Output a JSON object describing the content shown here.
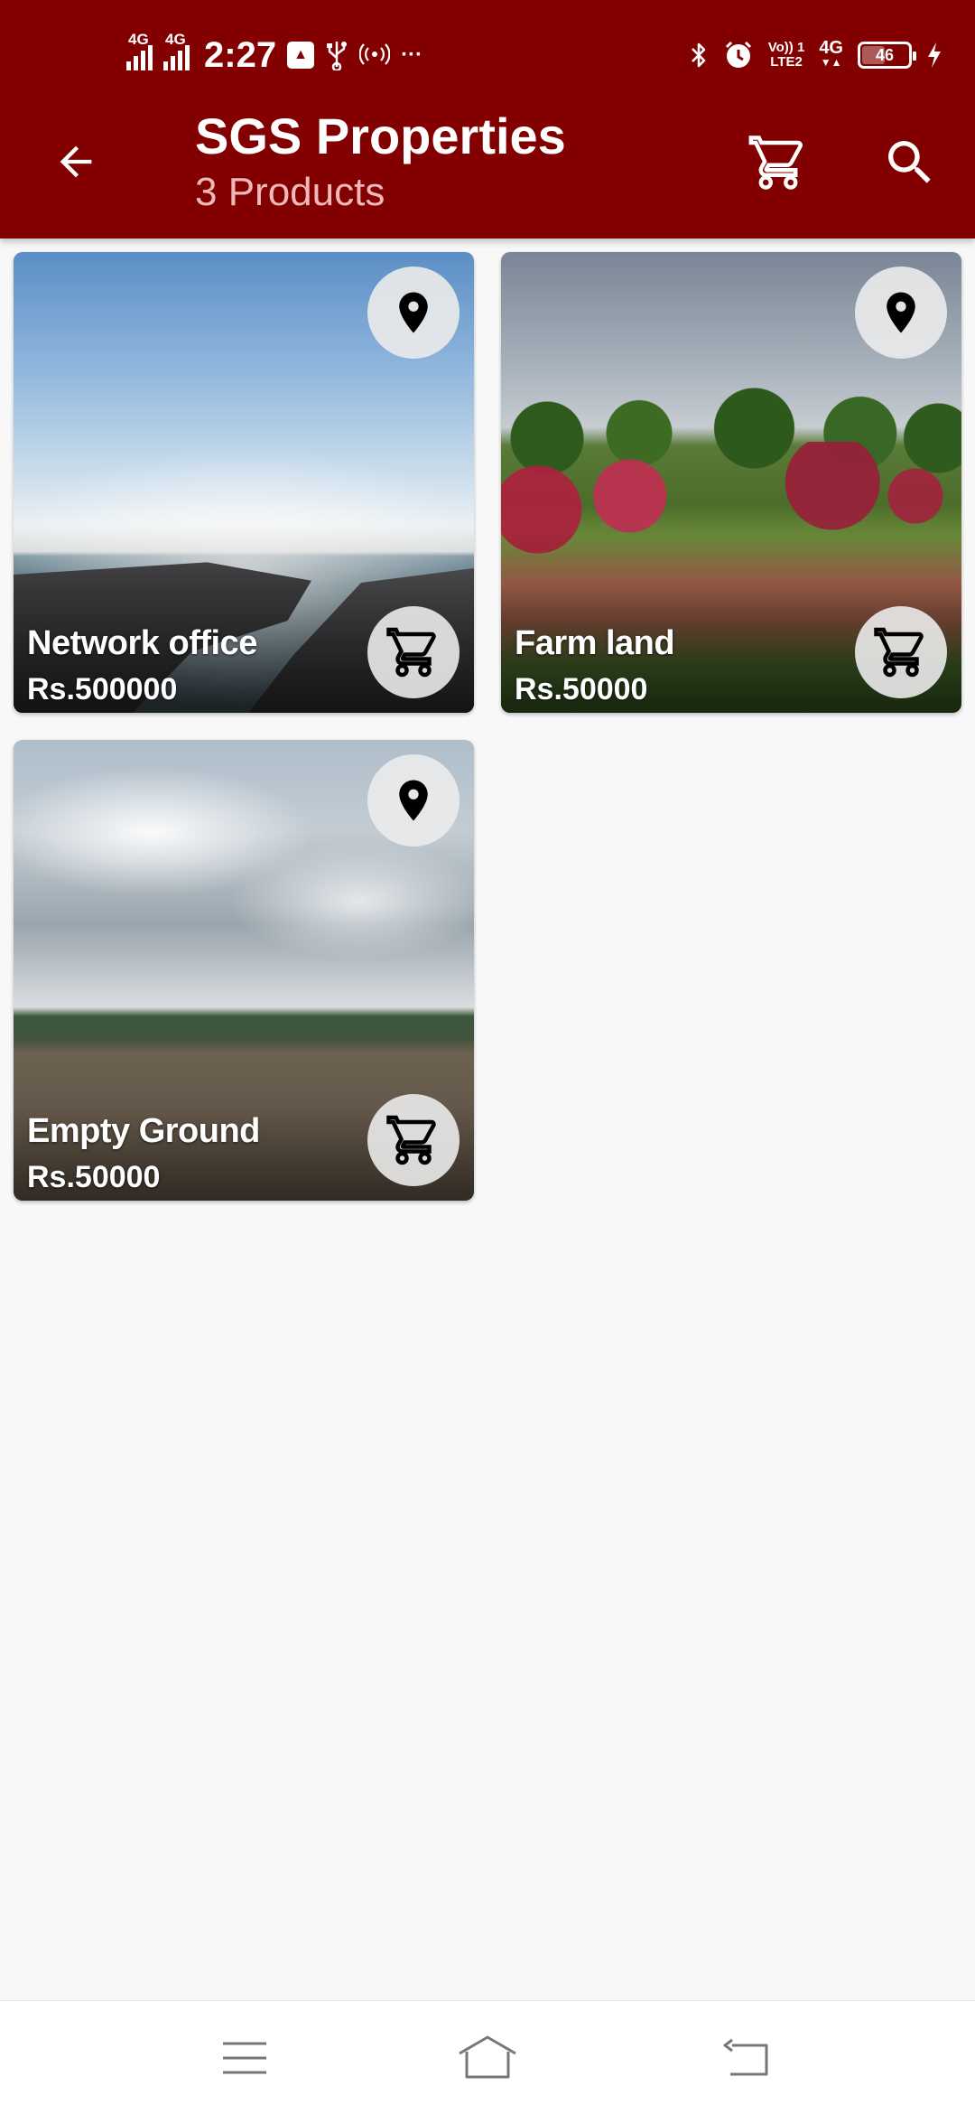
{
  "status_bar": {
    "time": "2:27",
    "signal_left_1": "4G",
    "signal_left_2": "4G",
    "volte_line1": "Vo)) 1",
    "volte_line2": "LTE2",
    "signal_right": "4G",
    "battery": "46",
    "more": "···",
    "icons": [
      "signal-icon",
      "signal-icon",
      "app-notification-icon",
      "usb-icon",
      "hotspot-icon",
      "more-icon",
      "bluetooth-icon",
      "alarm-icon",
      "signal-icon",
      "battery-icon",
      "charging-icon"
    ]
  },
  "app_bar": {
    "title": "SGS Properties",
    "subtitle": "3 Products",
    "background_color": "#820000",
    "icons": [
      "back-arrow-icon",
      "cart-icon",
      "search-icon"
    ]
  },
  "products": [
    {
      "name": "Network office",
      "price": "Rs.500000"
    },
    {
      "name": "Farm land",
      "price": "Rs.50000"
    },
    {
      "name": "Empty Ground",
      "price": "Rs.50000"
    }
  ],
  "nav_bar": {
    "icons": [
      "menu-icon",
      "home-icon",
      "back-icon"
    ]
  }
}
